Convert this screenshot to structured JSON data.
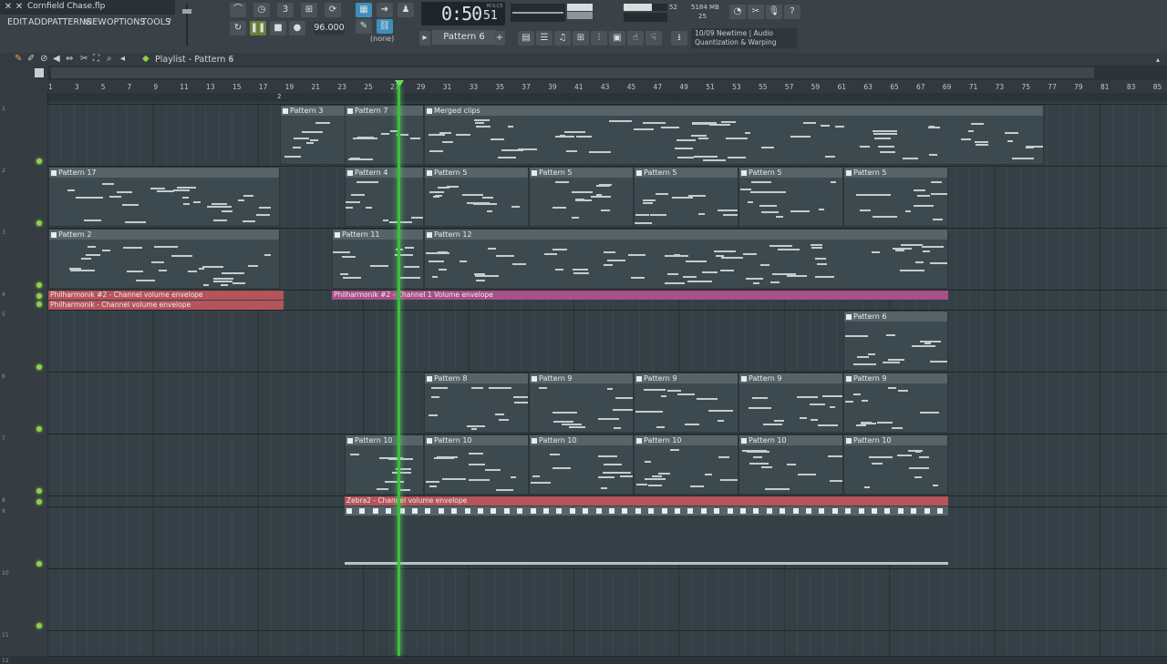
{
  "window": {
    "title": "Cornfield Chase.flp"
  },
  "menu": [
    "EDIT",
    "ADD",
    "PATTERNS",
    "VIEW",
    "OPTIONS",
    "TOOLS",
    "?"
  ],
  "transport": {
    "time": "0:50",
    "time_sub": "51",
    "time_unit": "M:S:CS",
    "tempo": "96.000",
    "pattern": "Pattern 6",
    "snap": "(none)"
  },
  "monitor": {
    "memory": "5184 MB",
    "cpu_value": "52",
    "polyphony": "25"
  },
  "hint": {
    "line1": "10/09  Newtime | Audio",
    "line2": "Quantization & Warping"
  },
  "playlist": {
    "title": "Playlist - Pattern 6"
  },
  "ruler": [
    "1",
    "3",
    "5",
    "7",
    "9",
    "11",
    "13",
    "15",
    "17",
    "19",
    "21",
    "23",
    "25",
    "27",
    "29",
    "31",
    "33",
    "35",
    "37",
    "39",
    "41",
    "43",
    "45",
    "47",
    "49",
    "51",
    "53",
    "55",
    "57",
    "59",
    "61",
    "63",
    "65",
    "67",
    "69",
    "71",
    "73",
    "75",
    "77",
    "79",
    "81",
    "83",
    "85"
  ],
  "marker": "2",
  "tracks": [
    "1",
    "2",
    "3",
    "4",
    "5",
    "6",
    "7",
    "8",
    "9",
    "10",
    "11",
    "12"
  ],
  "clips": [
    {
      "label": "Pattern 3",
      "track": 1
    },
    {
      "label": "Pattern 7",
      "track": 1
    },
    {
      "label": "Merged clips",
      "track": 1
    },
    {
      "label": "Pattern 17",
      "track": 2
    },
    {
      "label": "Pattern 4",
      "track": 2
    },
    {
      "label": "Pattern 5",
      "track": 2
    },
    {
      "label": "Pattern 2",
      "track": 3
    },
    {
      "label": "Pattern 11",
      "track": 3
    },
    {
      "label": "Pattern 12",
      "track": 3
    },
    {
      "label": "Pattern 6",
      "track": 6
    },
    {
      "label": "Pattern 8",
      "track": 7
    },
    {
      "label": "Pattern 9",
      "track": 7
    },
    {
      "label": "Pattern 10",
      "track": 8
    }
  ],
  "automation": {
    "a1": "Philharmonik #2 - Channel volume envelope",
    "a2": "Philharmonik - Channel volume envelope",
    "a3": "Philharmonik #2 - Channel 1 Volume envelope",
    "a4": "Zebra2 - Channel volume envelope"
  },
  "colors": {
    "accent": "#3fbf3f",
    "automation_red": "#b5545a",
    "automation_pink": "#a8508a"
  }
}
